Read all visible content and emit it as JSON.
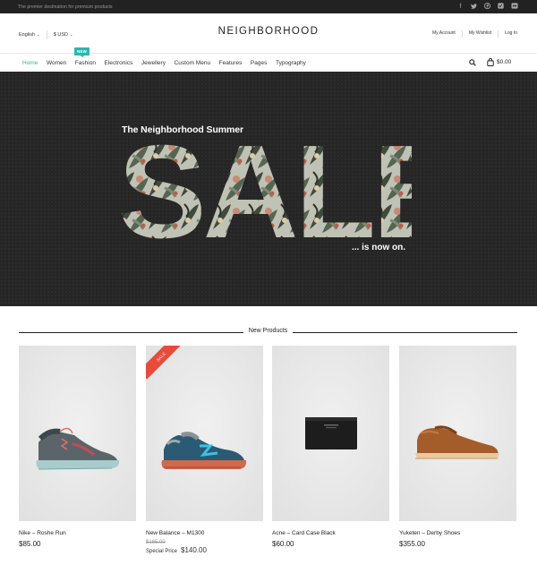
{
  "topbar": {
    "tagline": "The premier destination for premium products",
    "social_icons": [
      "facebook-icon",
      "twitter-icon",
      "pinterest-icon",
      "vimeo-icon",
      "flickr-icon"
    ]
  },
  "header": {
    "language": "English",
    "currency": "$ USD",
    "logo": "NEIGHBORHOOD",
    "account_links": [
      "My Account",
      "My Wishlist",
      "Log In"
    ]
  },
  "nav": {
    "items": [
      "Home",
      "Women",
      "Fashion",
      "Electronics",
      "Jewellery",
      "Custom Menu",
      "Features",
      "Pages",
      "Typography"
    ],
    "active": "Home",
    "badge": "NEW",
    "cart_total": "$0.00"
  },
  "hero": {
    "subtitle": "The Neighborhood Summer",
    "headline": "SALE",
    "tail": "... is now on."
  },
  "section": {
    "title": "New Products"
  },
  "products": [
    {
      "name": "Nike – Roshe Run",
      "price": "$85.00"
    },
    {
      "name": "New Balance – M1300",
      "old_price": "$165.00",
      "special_label": "Special Price",
      "special_price": "$140.00",
      "ribbon": "SALE"
    },
    {
      "name": "Acne – Card Case Black",
      "price": "$60.00"
    },
    {
      "name": "Yuketen – Derby Shoes",
      "price": "$355.00"
    }
  ],
  "colors": {
    "accent": "#2bb6b0",
    "sale": "#e84b3c",
    "hero_bg": "#262626"
  }
}
